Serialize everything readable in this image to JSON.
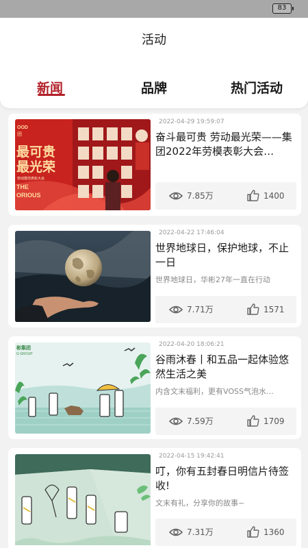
{
  "status_bar": {
    "battery": "83"
  },
  "header": {
    "title": "活动"
  },
  "tabs": [
    {
      "label": "新闻"
    },
    {
      "label": "品牌"
    },
    {
      "label": "热门活动"
    }
  ],
  "articles": [
    {
      "date": "2022-04-29 19:59:07",
      "title": "奋斗最可贵 劳动最光荣——集团2022年劳模表彰大会…",
      "subtitle": "",
      "views": "7.85万",
      "likes": "1400",
      "thumb_text": {
        "brand": "OOD",
        "brand2": "团",
        "line1": "最可贵",
        "line2": "最光荣",
        "small": "劳动模范表彰大会",
        "the": "THE",
        "glorious": "ORIOUS"
      }
    },
    {
      "date": "2022-04-22 17:46:04",
      "title": "世界地球日，保护地球，不止一日",
      "subtitle": "世界地球日，华彬27年一直在行动",
      "views": "7.71万",
      "likes": "1571"
    },
    {
      "date": "2022-04-20 18:06:21",
      "title": "谷雨沐春丨和五品一起体验悠然生活之美",
      "subtitle": "内含文末福利，更有VOSS气泡水…",
      "views": "7.59万",
      "likes": "1709",
      "thumb_text": {
        "logo": "彬集团",
        "logo2": "G GROUP"
      }
    },
    {
      "date": "2022-04-15 19:42:41",
      "title": "叮，你有五封春日明信片待签收!",
      "subtitle": "文末有礼，分享你的故事~",
      "views": "7.31万",
      "likes": "1360"
    }
  ],
  "colors": {
    "accent": "#b2222a",
    "background": "#f2f2f2"
  }
}
